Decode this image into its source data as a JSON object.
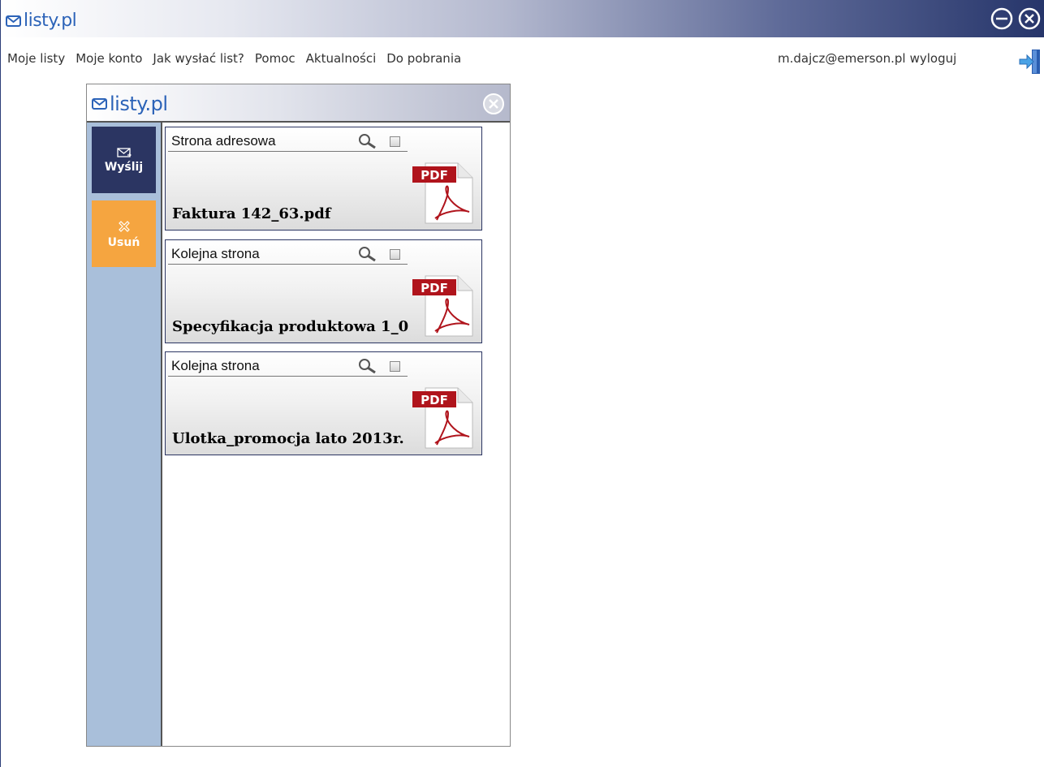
{
  "app": {
    "brand": "listy.pl",
    "window_controls": {
      "minimize_icon": "minus-circle-icon",
      "close_icon": "x-circle-icon"
    }
  },
  "nav": {
    "items": [
      "Moje listy",
      "Moje konto",
      "Jak wysłać list?",
      "Pomoc",
      "Aktualności",
      "Do pobrania"
    ]
  },
  "user": {
    "email": "m.dajcz@emerson.pl",
    "logout_label": "wyloguj",
    "logout_icon": "exit-door-icon"
  },
  "panel": {
    "brand": "listy.pl",
    "close_icon": "x-circle-icon",
    "actions": {
      "send_label": "Wyślij",
      "send_icon": "envelope-icon",
      "delete_label": "Usuń",
      "delete_icon": "x-icon"
    },
    "documents": [
      {
        "page_type": "Strona adresowa",
        "filename": "Faktura 142_63.pdf",
        "file_icon": "pdf-icon",
        "checked": false
      },
      {
        "page_type": "Kolejna strona",
        "filename": "Specyfikacja produktowa 1_0",
        "file_icon": "pdf-icon",
        "checked": false
      },
      {
        "page_type": "Kolejna strona",
        "filename": "Ulotka_promocja lato 2013r.",
        "file_icon": "pdf-icon",
        "checked": false
      }
    ]
  },
  "colors": {
    "brand_blue": "#2c63b8",
    "send_button": "#2b3562",
    "delete_button": "#f5a540",
    "sidebar": "#a9bfda"
  }
}
